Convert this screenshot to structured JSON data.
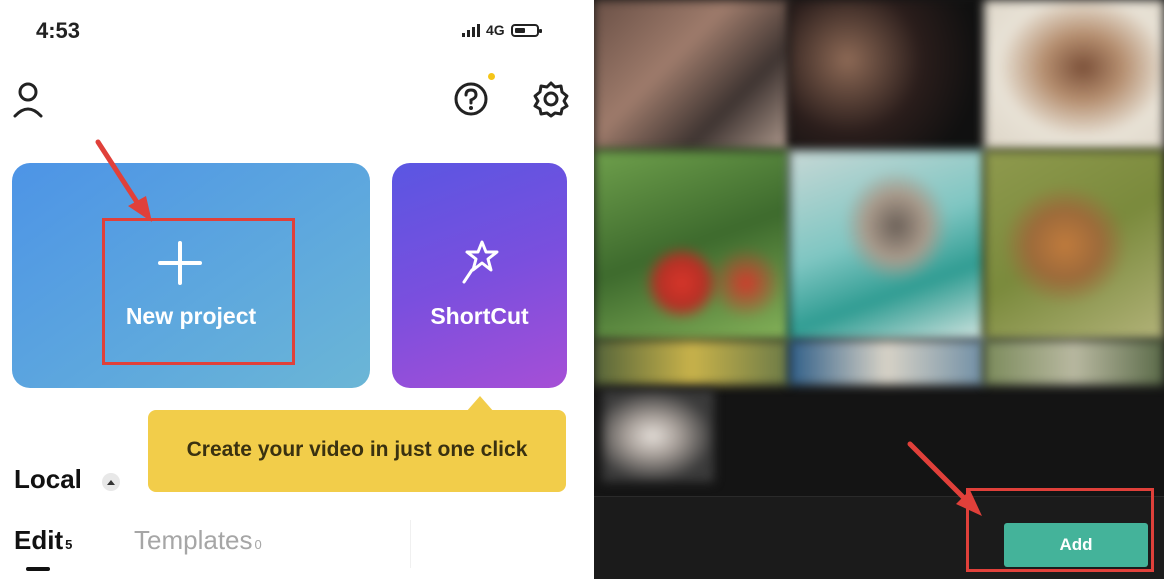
{
  "status_bar": {
    "time": "4:53",
    "network": "4G"
  },
  "header": {
    "profile_icon": "profile-icon",
    "help_icon": "question-icon",
    "settings_icon": "gear-icon",
    "notification_dot_color": "#f5c518"
  },
  "cards": {
    "new_project": {
      "label": "New project",
      "icon": "plus-icon"
    },
    "shortcut": {
      "label": "ShortCut",
      "icon": "magic-wand-icon"
    }
  },
  "tooltip": {
    "text": "Create your video in just one click"
  },
  "local": {
    "title": "Local",
    "tabs": [
      {
        "label": "Edit",
        "count": "5",
        "active": true
      },
      {
        "label": "Templates",
        "count": "0",
        "active": false
      }
    ]
  },
  "gallery": {
    "add_label": "Add"
  },
  "colors": {
    "annotation_red": "#e0403a",
    "add_button": "#44b39a",
    "tooltip": "#f2cd4a"
  }
}
